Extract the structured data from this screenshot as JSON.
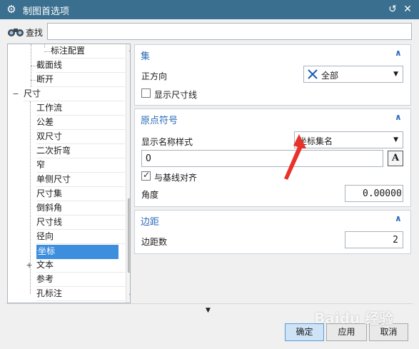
{
  "window": {
    "title": "制图首选项"
  },
  "search": {
    "label": "查找",
    "value": ""
  },
  "tree": {
    "items": [
      {
        "label": "标注配置"
      },
      {
        "label": "截面线"
      },
      {
        "label": "断开"
      },
      {
        "label": "尺寸",
        "expander": "−"
      },
      {
        "label": "工作流"
      },
      {
        "label": "公差"
      },
      {
        "label": "双尺寸"
      },
      {
        "label": "二次折弯"
      },
      {
        "label": "窄"
      },
      {
        "label": "单侧尺寸"
      },
      {
        "label": "尺寸集"
      },
      {
        "label": "倒斜角"
      },
      {
        "label": "尺寸线"
      },
      {
        "label": "径向"
      },
      {
        "label": "坐标",
        "selected": true
      },
      {
        "label": "文本",
        "expander": "+"
      },
      {
        "label": "参考"
      },
      {
        "label": "孔标注"
      }
    ]
  },
  "set_panel": {
    "title": "集",
    "direction_label": "正方向",
    "direction_value": "全部",
    "show_dim_line_label": "显示尺寸线",
    "show_dim_line_checked": false
  },
  "origin_panel": {
    "title": "原点符号",
    "name_style_label": "显示名称样式",
    "name_style_value": "坐标集名",
    "origin_text": "O",
    "align_baseline_label": "与基线对齐",
    "align_baseline_checked": true,
    "angle_label": "角度",
    "angle_value": "0.00000"
  },
  "margin_panel": {
    "title": "边距",
    "count_label": "边距数",
    "count_value": "2"
  },
  "buttons": {
    "ok": "确定",
    "apply": "应用",
    "cancel": "取消"
  },
  "colors": {
    "titlebar": "#3a6f8f",
    "accent": "#2a6bb8",
    "selection": "#3d8fde",
    "arrow": "#e8322a"
  },
  "watermark_text": "Baidu 经验"
}
